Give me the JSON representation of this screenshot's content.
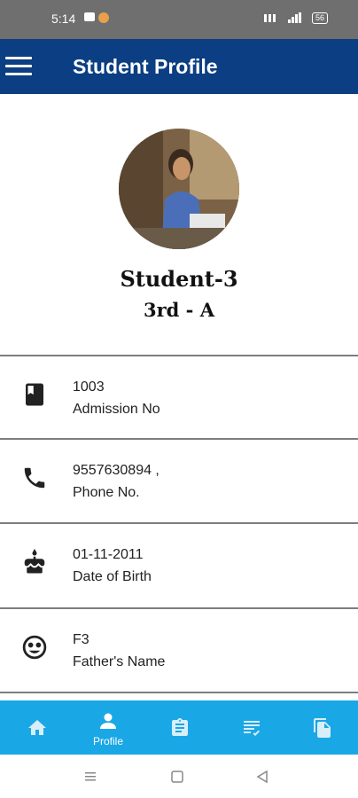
{
  "status_bar": {
    "time": "5:14",
    "battery": "56"
  },
  "header": {
    "title": "Student Profile"
  },
  "profile": {
    "name": "Student-3",
    "class": "3rd - A"
  },
  "details": [
    {
      "value": "1003",
      "label": "Admission No",
      "icon": "book-icon"
    },
    {
      "value": "9557630894 ,",
      "label": "Phone No.",
      "icon": "phone-icon"
    },
    {
      "value": "01-11-2011",
      "label": "Date of Birth",
      "icon": "cake-icon"
    },
    {
      "value": "F3",
      "label": "Father's Name",
      "icon": "face-icon"
    }
  ],
  "bottom_nav": [
    {
      "icon": "home-icon",
      "label": ""
    },
    {
      "icon": "profile-icon",
      "label": "Profile",
      "active": true
    },
    {
      "icon": "clipboard-icon",
      "label": ""
    },
    {
      "icon": "checklist-icon",
      "label": ""
    },
    {
      "icon": "documents-icon",
      "label": ""
    }
  ],
  "colors": {
    "header": "#0b3e82",
    "bottom_nav": "#1aa7e6",
    "status_bar": "#6f6f6f"
  }
}
